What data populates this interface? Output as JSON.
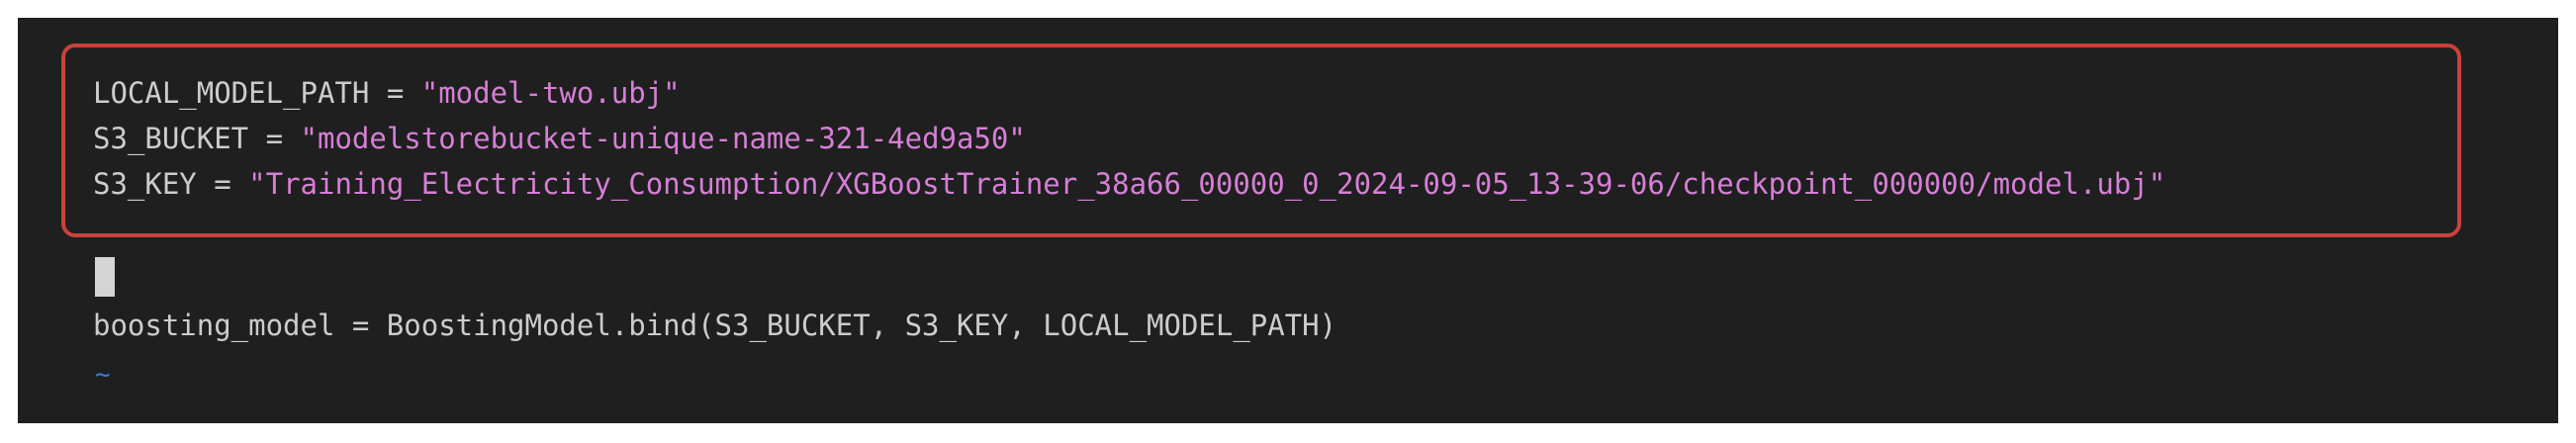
{
  "editor": {
    "lines": {
      "local_model_path": {
        "name": "LOCAL_MODEL_PATH",
        "op": " = ",
        "value": "\"model-two.ubj\""
      },
      "s3_bucket": {
        "name": "S3_BUCKET",
        "op": " = ",
        "value": "\"modelstorebucket-unique-name-321-4ed9a50\""
      },
      "s3_key": {
        "name": "S3_KEY",
        "op": " = ",
        "value": "\"Training_Electricity_Consumption/XGBoostTrainer_38a66_00000_0_2024-09-05_13-39-06/checkpoint_000000/model.ubj\""
      },
      "boosting_model": "boosting_model = BoostingModel.bind(S3_BUCKET, S3_KEY, LOCAL_MODEL_PATH)"
    },
    "empty_line_marker": "~"
  },
  "colors": {
    "background": "#1f1f1f",
    "text": "#cccccc",
    "string": "#d67fd6",
    "highlight_border": "#c8423b",
    "tilde": "#3a7bd5"
  }
}
